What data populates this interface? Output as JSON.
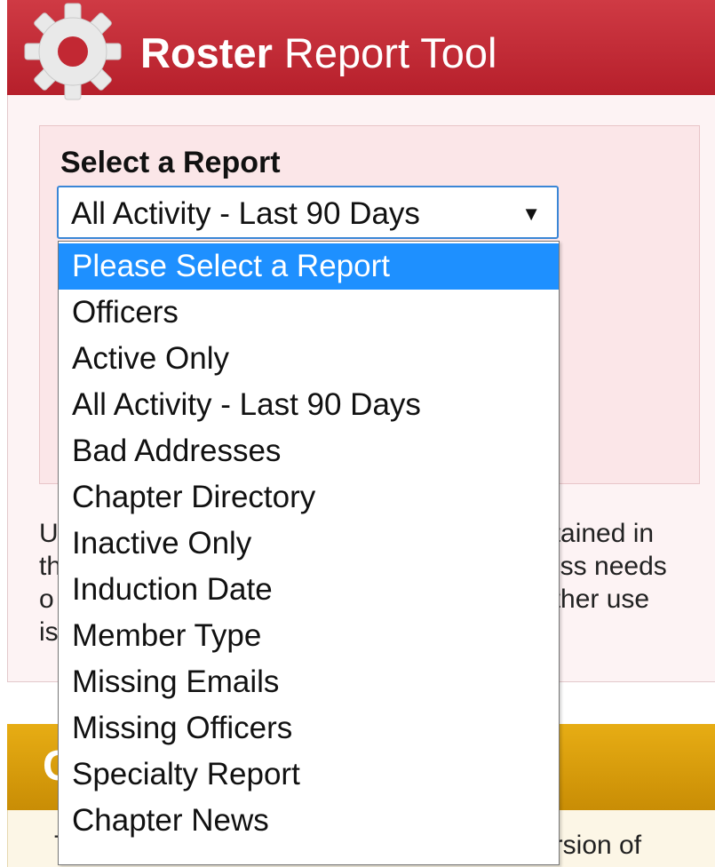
{
  "roster_panel": {
    "title_bold": "Roster",
    "title_rest": " Report Tool",
    "gear_icon": "gear-icon",
    "header_color": "#c22833",
    "select_label": "Select a Report",
    "selected_value": "All Activity - Last 90 Days",
    "arrow": "▼",
    "body_lines": [
      {
        "left": "U",
        "right": "ntained in"
      },
      {
        "left": "th",
        "right": "ess needs"
      },
      {
        "left": "o",
        "right": "other use"
      },
      {
        "left": "is",
        "right": ""
      }
    ]
  },
  "dropdown": {
    "highlight_color": "#1e90ff",
    "options": [
      "Please Select a Report",
      "Officers",
      "Active Only",
      "All Activity - Last 90 Days",
      "Bad Addresses",
      "Chapter Directory",
      "Inactive Only",
      "Induction Date",
      "Member Type",
      "Missing Emails",
      "Missing Officers",
      "Specialty Report",
      "Chapter News"
    ]
  },
  "chapter_panel": {
    "title": "C",
    "header_color": "#d99a0b",
    "body_left": "T",
    "body_right": "ersion of"
  }
}
